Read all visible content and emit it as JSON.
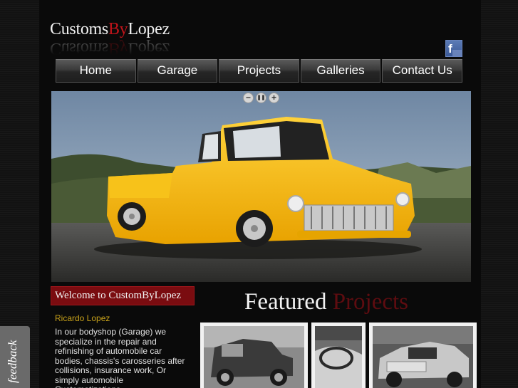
{
  "logo": {
    "part1": "Customs",
    "part2": "By",
    "part3": "Lopez"
  },
  "social": {
    "facebook_letter": "f"
  },
  "nav": {
    "items": [
      {
        "label": "Home"
      },
      {
        "label": "Garage"
      },
      {
        "label": "Projects"
      },
      {
        "label": "Galleries"
      },
      {
        "label": "Contact Us"
      }
    ]
  },
  "slider": {
    "controls": {
      "prev": "−",
      "pause": "❚❚",
      "next": "+"
    }
  },
  "welcome": {
    "heading": "Welcome to CustomByLopez",
    "author": "Ricardo Lopez",
    "text": "In our bodyshop (Garage) we specialize in the repair and refinishing of automobile car bodies, chassis's carosseries after collisions, insurance work, Or simply automobile Customatizations."
  },
  "featured": {
    "part1": "Featured",
    "part2": "Projects"
  },
  "feedback": {
    "label": "feedback"
  },
  "colors": {
    "accent_red": "#c0141a",
    "truck_yellow": "#f2b705",
    "welcome_bg": "#7a0c10"
  }
}
